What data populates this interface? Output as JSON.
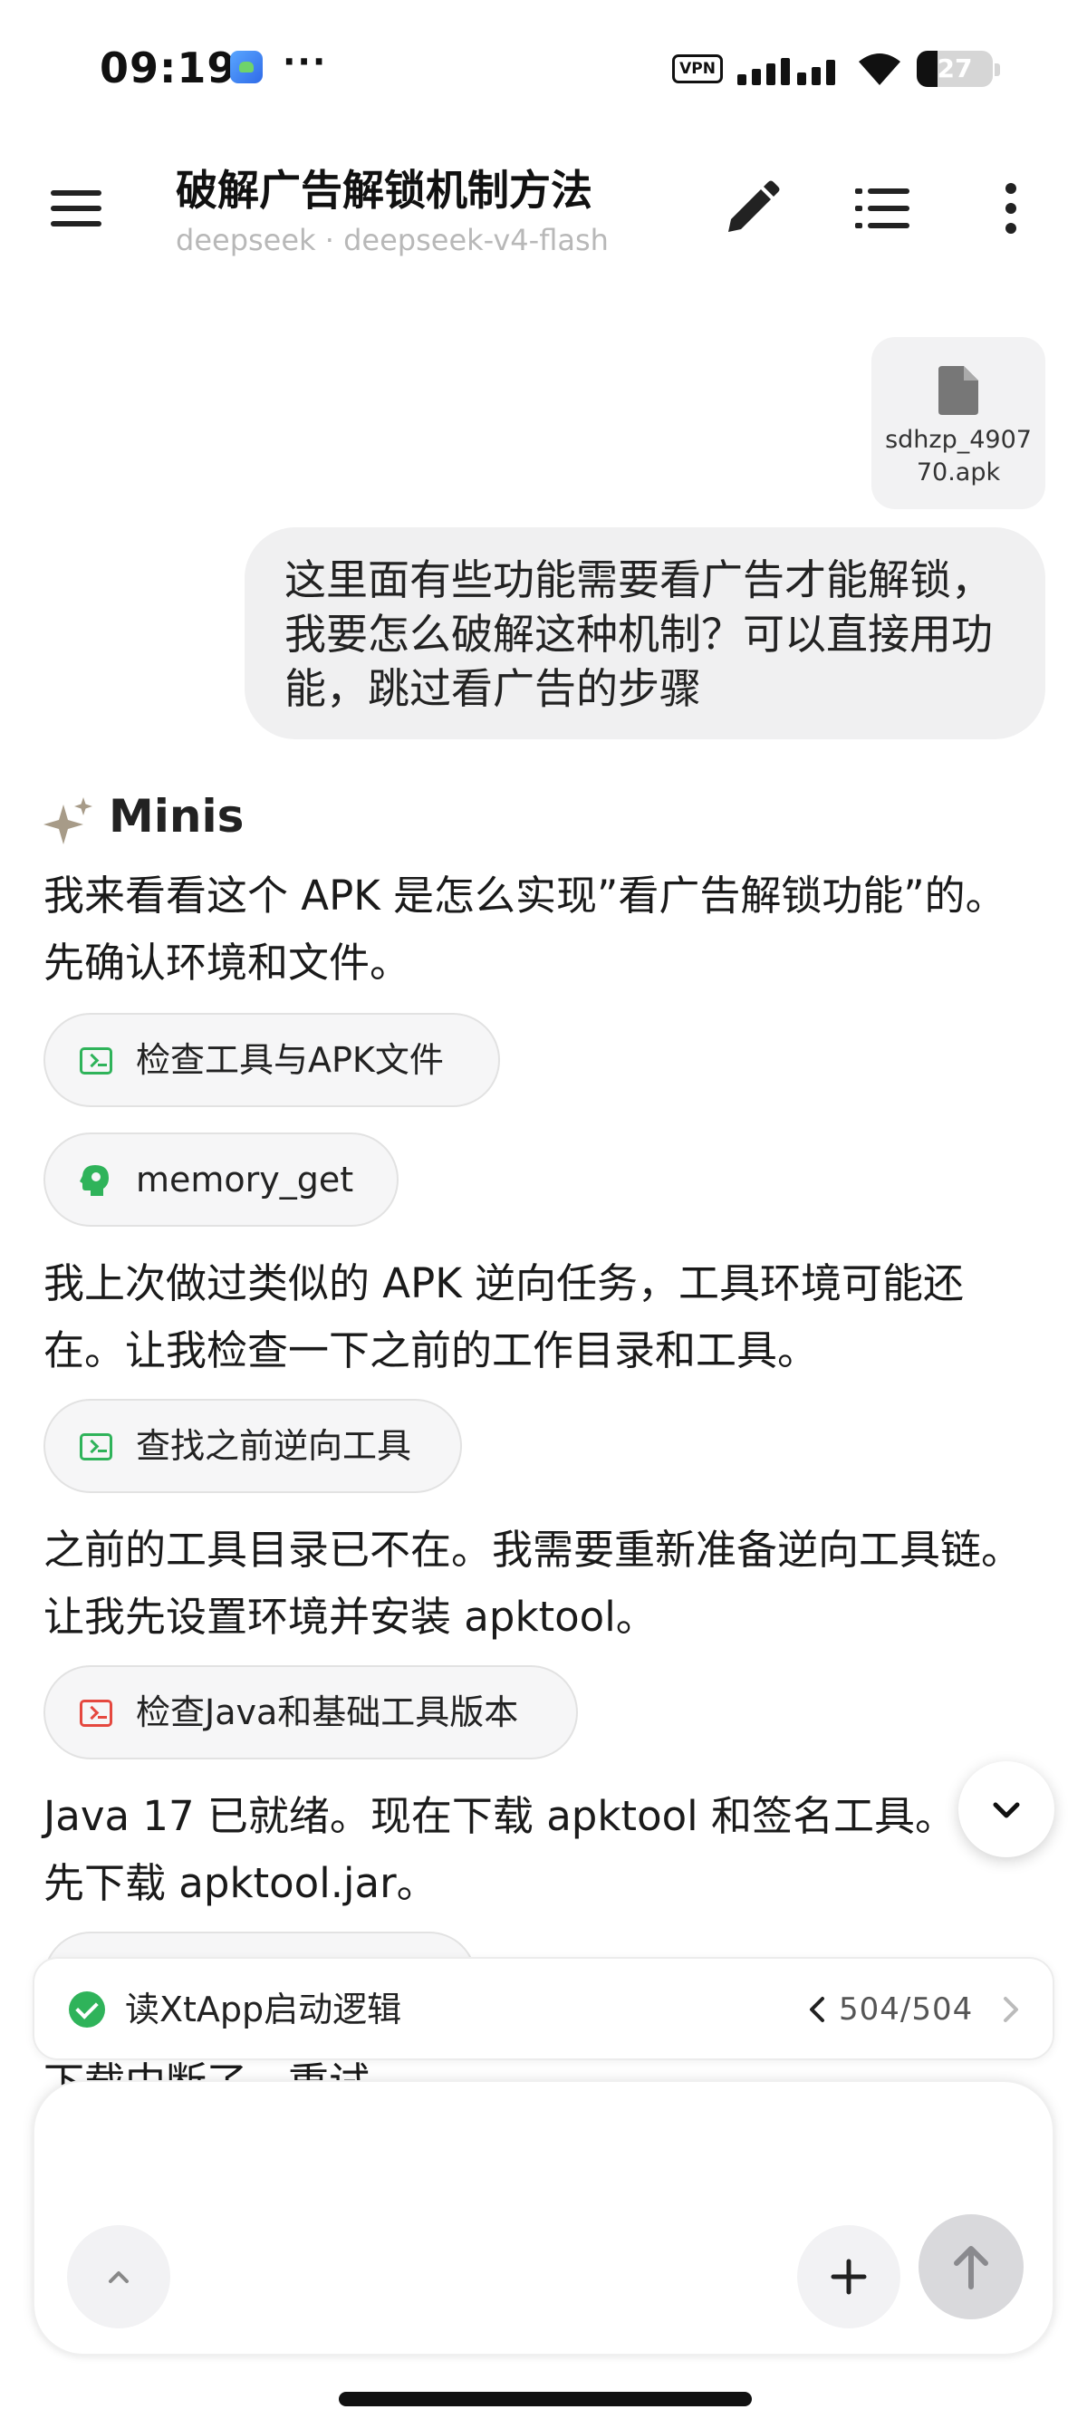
{
  "status_bar": {
    "time": "09:19",
    "notification_dots": "···",
    "vpn_label": "VPN",
    "battery_level": "27",
    "battery_fraction": 0.27
  },
  "header": {
    "title": "破解广告解锁机制方法",
    "subtitle": "deepseek · deepseek-v4-flash"
  },
  "icons": {
    "menu": "menu-icon",
    "edit": "edit-icon",
    "list": "list-icon",
    "more": "more-vert-icon",
    "file": "file-icon",
    "sparkle": "sparkle-icon",
    "terminal": "terminal-icon",
    "memory": "brain-icon",
    "check": "check-circle-icon",
    "chevron_down": "chevron-down-icon",
    "chevron_up": "chevron-up-icon",
    "plus": "plus-icon",
    "send": "arrow-up-icon"
  },
  "conversation": {
    "attachment": {
      "filename": "sdhzp_490770.apk"
    },
    "user_message": "这里面有些功能需要看广告才能解锁，我要怎么破解这种机制？可以直接用功能，跳过看广告的步骤",
    "assistant_name": "Minis",
    "paragraphs": [
      "我来看看这个 APK 是怎么实现”看广告解锁功能”的。先确认环境和文件。",
      "我上次做过类似的 APK 逆向任务，工具环境可能还在。让我检查一下之前的工作目录和工具。",
      "之前的工具目录已不在。我需要重新准备逆向工具链。让我先设置环境并安装 apktool。",
      "Java 17 已就绪。现在下载 apktool 和签名工具。先下载 apktool.jar。"
    ],
    "tool_chips": [
      {
        "label": "检查工具与APK文件",
        "status_color": "#2fb35a"
      },
      {
        "label": "memory_get",
        "status_color": "#2fb35a"
      },
      {
        "label": "查找之前逆向工具",
        "status_color": "#2fb35a"
      },
      {
        "label": "检查Java和基础工具版本",
        "status_color": "#e5483f"
      }
    ],
    "partial_text": "下载中断了，重试"
  },
  "progress": {
    "title": "读XtApp启动逻辑",
    "count": "504/504"
  },
  "composer": {
    "placeholder": ""
  },
  "colors": {
    "success": "#2fb35a",
    "error": "#e5483f",
    "bubble": "#f0f0f1"
  }
}
